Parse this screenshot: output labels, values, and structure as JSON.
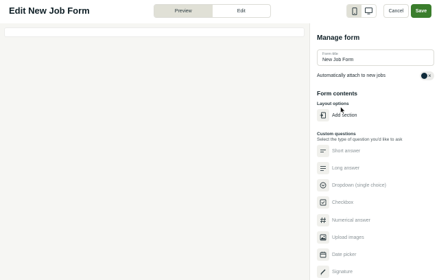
{
  "header": {
    "title": "Edit New Job Form",
    "tabs": [
      {
        "label": "Preview",
        "active": true
      },
      {
        "label": "Edit",
        "active": false
      }
    ],
    "devices": [
      {
        "icon": "phone-icon",
        "active": true
      },
      {
        "icon": "desktop-icon",
        "active": false
      }
    ],
    "cancel_label": "Cancel",
    "save_label": "Save"
  },
  "panel": {
    "title": "Manage form",
    "form_title_label": "Form title",
    "form_title_value": "New Job Form",
    "auto_attach_label": "Automatically attach to new jobs",
    "form_contents_title": "Form contents",
    "layout_options": {
      "heading": "Layout options",
      "items": [
        {
          "label": "Add section",
          "icon": "add-section-icon"
        }
      ]
    },
    "custom_questions": {
      "heading": "Custom questions",
      "description": "Select the type of question you'd like to ask",
      "items": [
        {
          "label": "Short answer",
          "icon": "short-answer-icon"
        },
        {
          "label": "Long answer",
          "icon": "long-answer-icon"
        },
        {
          "label": "Dropdown (single choice)",
          "icon": "dropdown-icon"
        },
        {
          "label": "Checkbox",
          "icon": "checkbox-icon"
        },
        {
          "label": "Numerical answer",
          "icon": "hash-icon"
        },
        {
          "label": "Upload images",
          "icon": "image-icon"
        },
        {
          "label": "Date picker",
          "icon": "calendar-icon"
        },
        {
          "label": "Signature",
          "icon": "pen-icon"
        }
      ]
    }
  },
  "colors": {
    "save": "#3a7d2c",
    "active_segment": "#e0e0d6",
    "preview_bg": "#f6f6f3",
    "toggle_knob": "#0f2a3a"
  }
}
